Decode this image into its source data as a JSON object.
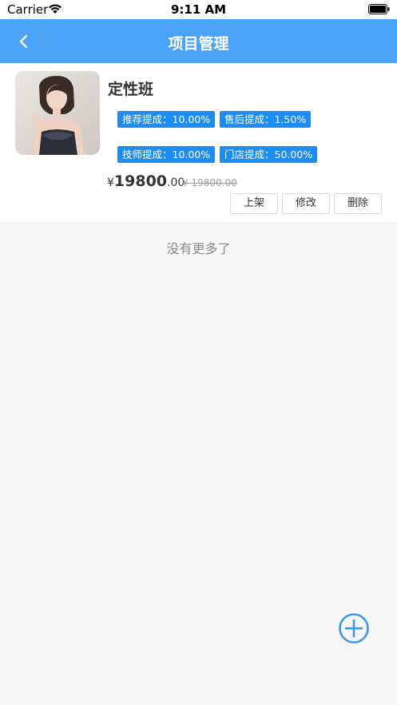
{
  "status_bar": {
    "carrier": "Carrier",
    "time": "9:11 AM"
  },
  "nav": {
    "title": "项目管理",
    "back_icon": "chevron-left-icon"
  },
  "item": {
    "name": "定性班",
    "tags": [
      "推荐提成：10.00%",
      "售后提成：1.50%",
      "技师提成：10.00%",
      "门店提成：50.00%"
    ],
    "price_symbol": "¥",
    "price_int": "19800",
    "price_dec": ".00",
    "original_price": "¥ 19800.00",
    "actions": {
      "shelf": "上架",
      "edit": "修改",
      "delete": "删除"
    }
  },
  "list_footer": "没有更多了",
  "colors": {
    "nav": "#4aa3f6",
    "tag": "#1f8cf0",
    "fab": "#3a97ea"
  },
  "fab_icon": "plus-circle-icon"
}
